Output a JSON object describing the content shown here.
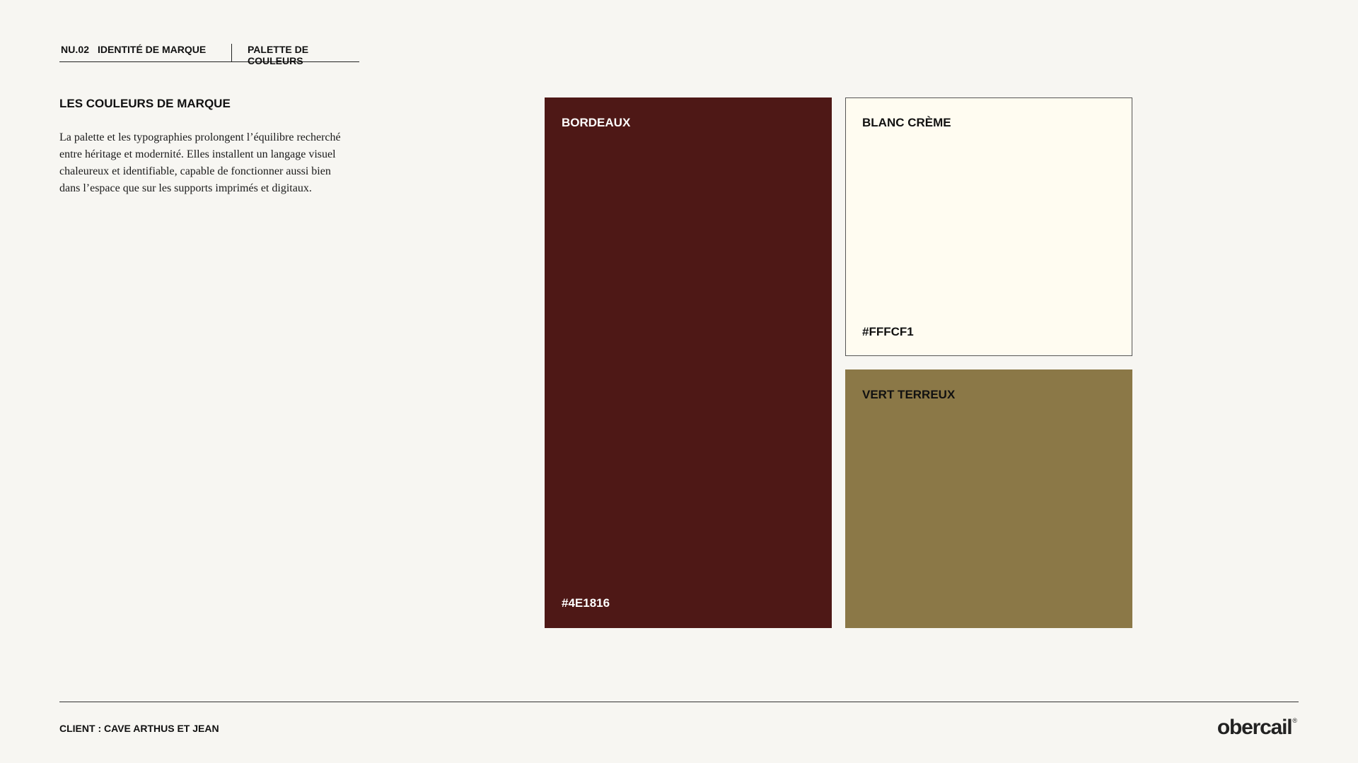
{
  "header": {
    "number": "NU.02",
    "section": "IDENTITÉ DE MARQUE",
    "page": "PALETTE DE COULEURS"
  },
  "intro": {
    "title": "LES COULEURS DE MARQUE",
    "body": "La palette et les typographies prolongent l’équilibre recherché entre héritage et modernité. Elles installent un langage visuel chaleureux et identifiable, capable de fonctionner aussi bien dans l’espace que sur les supports imprimés et digitaux."
  },
  "swatches": {
    "bordeaux": {
      "name": "BORDEAUX",
      "hex": "#4E1816",
      "color": "#4E1816"
    },
    "creme": {
      "name": "BLANC CRÈME",
      "hex": "#FFFCF1",
      "color": "#FFFCF1"
    },
    "vert": {
      "name": "VERT TERREUX",
      "color": "#8B7847"
    }
  },
  "footer": {
    "client": "CLIENT : CAVE ARTHUS ET JEAN",
    "logo": "obercail",
    "logo_mark": "®"
  }
}
